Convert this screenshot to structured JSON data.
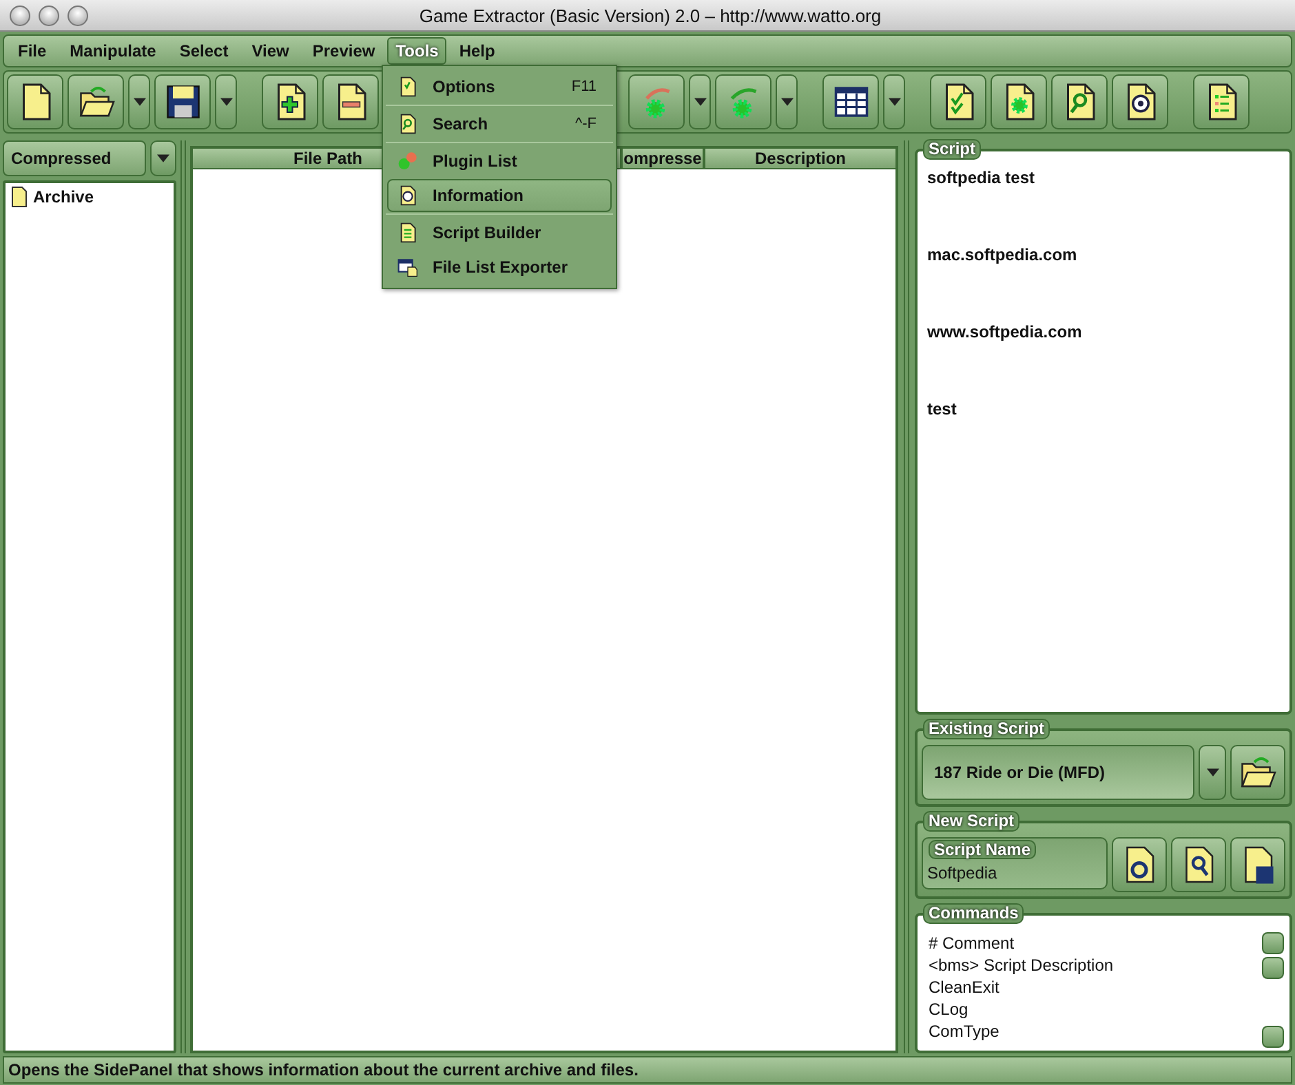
{
  "window": {
    "title": "Game Extractor (Basic Version) 2.0 – http://www.watto.org"
  },
  "menu_bar": [
    {
      "label": "File",
      "selected": false
    },
    {
      "label": "Manipulate",
      "selected": false
    },
    {
      "label": "Select",
      "selected": false
    },
    {
      "label": "View",
      "selected": false
    },
    {
      "label": "Preview",
      "selected": false
    },
    {
      "label": "Tools",
      "selected": true
    },
    {
      "label": "Help",
      "selected": false
    }
  ],
  "tools_menu": [
    {
      "label": "Options",
      "shortcut": "F11",
      "selected": false,
      "separator_after": true
    },
    {
      "label": "Search",
      "shortcut": "^-F",
      "selected": false,
      "separator_after": true
    },
    {
      "label": "Plugin List",
      "selected": false,
      "separator_after": false
    },
    {
      "label": "Information",
      "selected": true,
      "separator_after": true
    },
    {
      "label": "Script Builder",
      "selected": false,
      "separator_after": false
    },
    {
      "label": "File List Exporter",
      "selected": false,
      "separator_after": false
    }
  ],
  "toolbar": [
    [
      {
        "kind": "new",
        "dropdown": false
      },
      {
        "kind": "open",
        "dropdown": true
      },
      {
        "kind": "save",
        "dropdown": true
      }
    ],
    [
      {
        "kind": "add",
        "dropdown": false
      },
      {
        "kind": "remove",
        "dropdown": false
      }
    ],
    [
      {
        "kind": "extract-left",
        "dropdown": true
      },
      {
        "kind": "extract-right",
        "dropdown": true
      }
    ],
    [
      {
        "kind": "table",
        "dropdown": true
      }
    ],
    [
      {
        "kind": "check",
        "dropdown": false
      },
      {
        "kind": "gear-doc",
        "dropdown": false
      },
      {
        "kind": "search",
        "dropdown": false
      },
      {
        "kind": "help",
        "dropdown": false
      }
    ],
    [
      {
        "kind": "list",
        "dropdown": false
      }
    ]
  ],
  "left_panel": {
    "view": "Compressed",
    "tree": [
      {
        "label": "Archive"
      }
    ]
  },
  "file_table": {
    "columns": [
      "File Path",
      "ompresse",
      "Description"
    ]
  },
  "script": {
    "title": "Script",
    "lines": [
      "softpedia test",
      "mac.softpedia.com",
      "www.softpedia.com",
      "test"
    ]
  },
  "existing_script": {
    "title": "Existing Script",
    "value": "187 Ride or Die (MFD)"
  },
  "new_script": {
    "title": "New Script",
    "field_label": "Script Name",
    "value": "Softpedia"
  },
  "commands": {
    "title": "Commands",
    "items": [
      "# Comment",
      "<bms> Script Description",
      "CleanExit",
      "CLog",
      "ComType"
    ]
  },
  "status_bar": "Opens the SidePanel that shows information about the current archive and files."
}
